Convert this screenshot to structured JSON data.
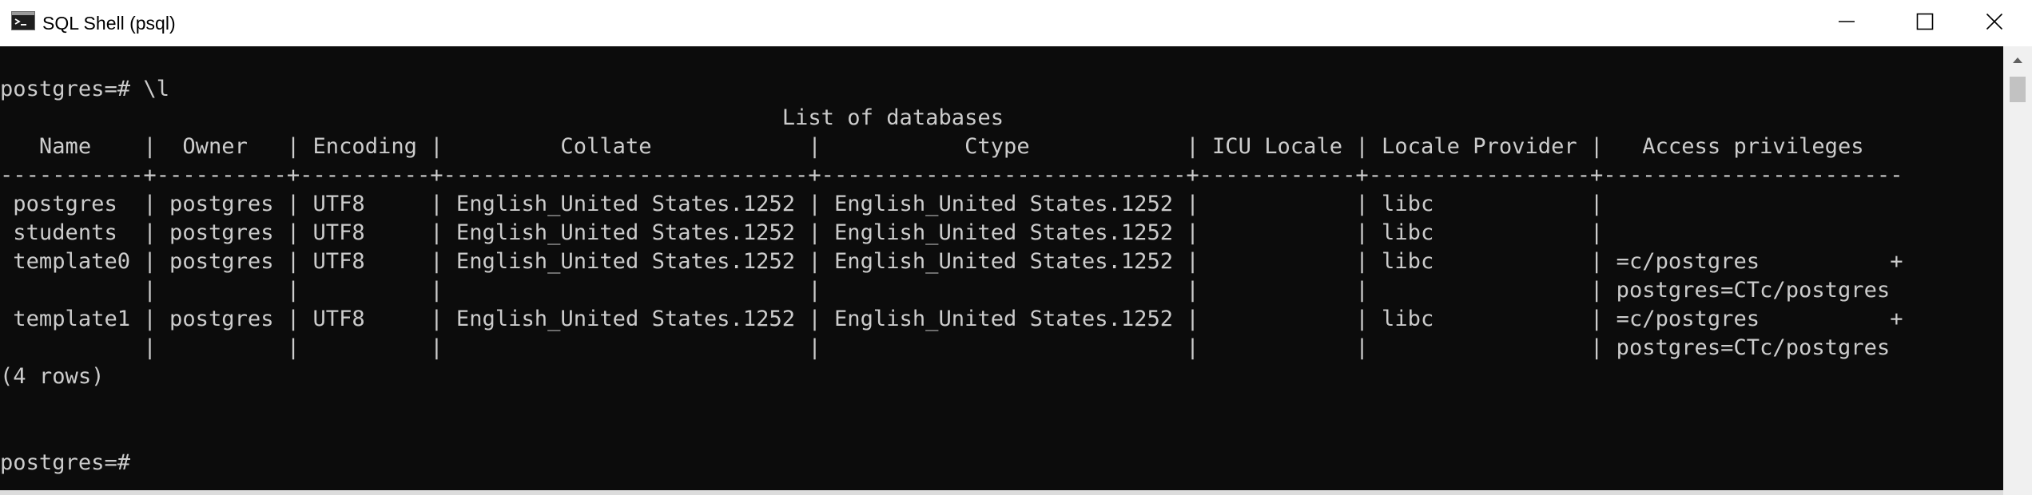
{
  "window": {
    "title": "SQL Shell (psql)",
    "icon": "console-app-icon",
    "controls": [
      "minimize-icon",
      "maximize-icon",
      "close-icon"
    ]
  },
  "terminal": {
    "lines": [
      "postgres=# \\l",
      "                                                            List of databases",
      "   Name    |  Owner   | Encoding |         Collate            |           Ctype            | ICU Locale | Locale Provider |   Access privileges",
      "-----------+----------+----------+----------------------------+----------------------------+------------+-----------------+-----------------------",
      " postgres  | postgres | UTF8     | English_United States.1252 | English_United States.1252 |            | libc            |",
      " students  | postgres | UTF8     | English_United States.1252 | English_United States.1252 |            | libc            |",
      " template0 | postgres | UTF8     | English_United States.1252 | English_United States.1252 |            | libc            | =c/postgres          +",
      "           |          |          |                            |                            |            |                 | postgres=CTc/postgres",
      " template1 | postgres | UTF8     | English_United States.1252 | English_United States.1252 |            | libc            | =c/postgres          +",
      "           |          |          |                            |                            |            |                 | postgres=CTc/postgres",
      "(4 rows)",
      "",
      "",
      "postgres=#"
    ]
  },
  "colors": {
    "background": "#0c0c0c",
    "text": "#cccccc",
    "titlebar": "#ffffff",
    "scrollbar": "#f0f0f0"
  }
}
